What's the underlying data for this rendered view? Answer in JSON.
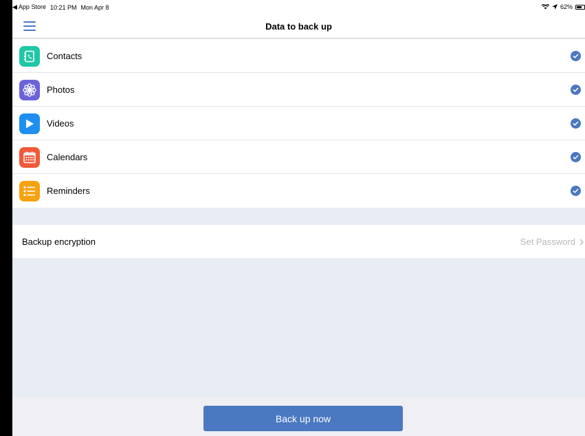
{
  "status_bar": {
    "back_app": "◀ App Store",
    "time": "10:21 PM",
    "date": "Mon Apr 8",
    "battery": "62%"
  },
  "nav": {
    "title": "Data to back up"
  },
  "items": [
    {
      "label": "Contacts",
      "icon": "contacts-icon",
      "color": "#1fc7a6",
      "checked": true
    },
    {
      "label": "Photos",
      "icon": "photos-icon",
      "color": "#6c63d9",
      "checked": true
    },
    {
      "label": "Videos",
      "icon": "play-icon",
      "color": "#1e8ff0",
      "checked": true
    },
    {
      "label": "Calendars",
      "icon": "calendar-icon",
      "color": "#f05a3a",
      "checked": true
    },
    {
      "label": "Reminders",
      "icon": "list-icon",
      "color": "#f7a20f",
      "checked": true
    }
  ],
  "encryption": {
    "label": "Backup encryption",
    "action": "Set Password"
  },
  "footer": {
    "button_label": "Back up now"
  },
  "colors": {
    "accent": "#4a78c1",
    "background": "#e8ecf3"
  }
}
